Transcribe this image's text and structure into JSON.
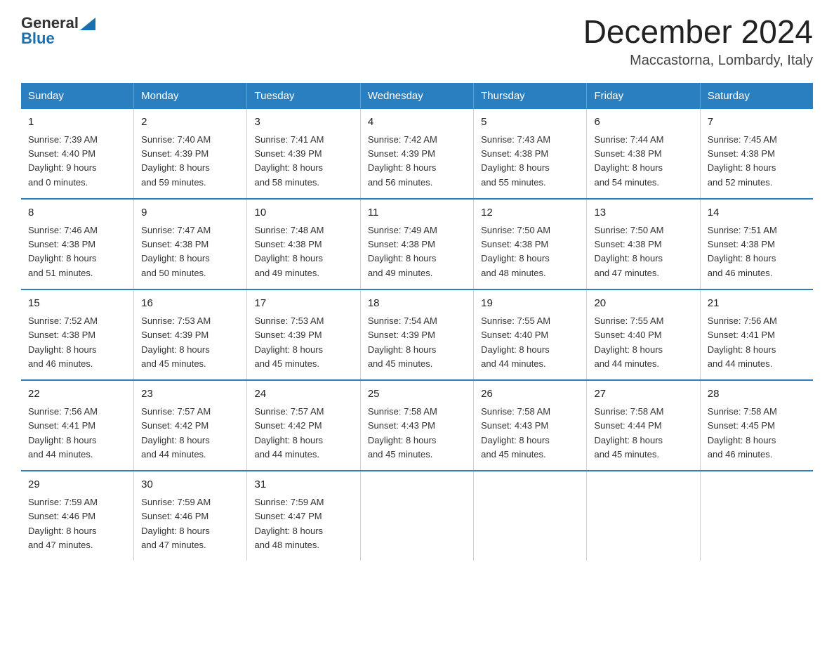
{
  "logo": {
    "text_general": "General",
    "text_blue": "Blue",
    "arrow": "▲"
  },
  "title": "December 2024",
  "location": "Maccastorna, Lombardy, Italy",
  "days_of_week": [
    "Sunday",
    "Monday",
    "Tuesday",
    "Wednesday",
    "Thursday",
    "Friday",
    "Saturday"
  ],
  "weeks": [
    [
      {
        "day": "1",
        "info": "Sunrise: 7:39 AM\nSunset: 4:40 PM\nDaylight: 9 hours\nand 0 minutes."
      },
      {
        "day": "2",
        "info": "Sunrise: 7:40 AM\nSunset: 4:39 PM\nDaylight: 8 hours\nand 59 minutes."
      },
      {
        "day": "3",
        "info": "Sunrise: 7:41 AM\nSunset: 4:39 PM\nDaylight: 8 hours\nand 58 minutes."
      },
      {
        "day": "4",
        "info": "Sunrise: 7:42 AM\nSunset: 4:39 PM\nDaylight: 8 hours\nand 56 minutes."
      },
      {
        "day": "5",
        "info": "Sunrise: 7:43 AM\nSunset: 4:38 PM\nDaylight: 8 hours\nand 55 minutes."
      },
      {
        "day": "6",
        "info": "Sunrise: 7:44 AM\nSunset: 4:38 PM\nDaylight: 8 hours\nand 54 minutes."
      },
      {
        "day": "7",
        "info": "Sunrise: 7:45 AM\nSunset: 4:38 PM\nDaylight: 8 hours\nand 52 minutes."
      }
    ],
    [
      {
        "day": "8",
        "info": "Sunrise: 7:46 AM\nSunset: 4:38 PM\nDaylight: 8 hours\nand 51 minutes."
      },
      {
        "day": "9",
        "info": "Sunrise: 7:47 AM\nSunset: 4:38 PM\nDaylight: 8 hours\nand 50 minutes."
      },
      {
        "day": "10",
        "info": "Sunrise: 7:48 AM\nSunset: 4:38 PM\nDaylight: 8 hours\nand 49 minutes."
      },
      {
        "day": "11",
        "info": "Sunrise: 7:49 AM\nSunset: 4:38 PM\nDaylight: 8 hours\nand 49 minutes."
      },
      {
        "day": "12",
        "info": "Sunrise: 7:50 AM\nSunset: 4:38 PM\nDaylight: 8 hours\nand 48 minutes."
      },
      {
        "day": "13",
        "info": "Sunrise: 7:50 AM\nSunset: 4:38 PM\nDaylight: 8 hours\nand 47 minutes."
      },
      {
        "day": "14",
        "info": "Sunrise: 7:51 AM\nSunset: 4:38 PM\nDaylight: 8 hours\nand 46 minutes."
      }
    ],
    [
      {
        "day": "15",
        "info": "Sunrise: 7:52 AM\nSunset: 4:38 PM\nDaylight: 8 hours\nand 46 minutes."
      },
      {
        "day": "16",
        "info": "Sunrise: 7:53 AM\nSunset: 4:39 PM\nDaylight: 8 hours\nand 45 minutes."
      },
      {
        "day": "17",
        "info": "Sunrise: 7:53 AM\nSunset: 4:39 PM\nDaylight: 8 hours\nand 45 minutes."
      },
      {
        "day": "18",
        "info": "Sunrise: 7:54 AM\nSunset: 4:39 PM\nDaylight: 8 hours\nand 45 minutes."
      },
      {
        "day": "19",
        "info": "Sunrise: 7:55 AM\nSunset: 4:40 PM\nDaylight: 8 hours\nand 44 minutes."
      },
      {
        "day": "20",
        "info": "Sunrise: 7:55 AM\nSunset: 4:40 PM\nDaylight: 8 hours\nand 44 minutes."
      },
      {
        "day": "21",
        "info": "Sunrise: 7:56 AM\nSunset: 4:41 PM\nDaylight: 8 hours\nand 44 minutes."
      }
    ],
    [
      {
        "day": "22",
        "info": "Sunrise: 7:56 AM\nSunset: 4:41 PM\nDaylight: 8 hours\nand 44 minutes."
      },
      {
        "day": "23",
        "info": "Sunrise: 7:57 AM\nSunset: 4:42 PM\nDaylight: 8 hours\nand 44 minutes."
      },
      {
        "day": "24",
        "info": "Sunrise: 7:57 AM\nSunset: 4:42 PM\nDaylight: 8 hours\nand 44 minutes."
      },
      {
        "day": "25",
        "info": "Sunrise: 7:58 AM\nSunset: 4:43 PM\nDaylight: 8 hours\nand 45 minutes."
      },
      {
        "day": "26",
        "info": "Sunrise: 7:58 AM\nSunset: 4:43 PM\nDaylight: 8 hours\nand 45 minutes."
      },
      {
        "day": "27",
        "info": "Sunrise: 7:58 AM\nSunset: 4:44 PM\nDaylight: 8 hours\nand 45 minutes."
      },
      {
        "day": "28",
        "info": "Sunrise: 7:58 AM\nSunset: 4:45 PM\nDaylight: 8 hours\nand 46 minutes."
      }
    ],
    [
      {
        "day": "29",
        "info": "Sunrise: 7:59 AM\nSunset: 4:46 PM\nDaylight: 8 hours\nand 47 minutes."
      },
      {
        "day": "30",
        "info": "Sunrise: 7:59 AM\nSunset: 4:46 PM\nDaylight: 8 hours\nand 47 minutes."
      },
      {
        "day": "31",
        "info": "Sunrise: 7:59 AM\nSunset: 4:47 PM\nDaylight: 8 hours\nand 48 minutes."
      },
      {
        "day": "",
        "info": ""
      },
      {
        "day": "",
        "info": ""
      },
      {
        "day": "",
        "info": ""
      },
      {
        "day": "",
        "info": ""
      }
    ]
  ]
}
